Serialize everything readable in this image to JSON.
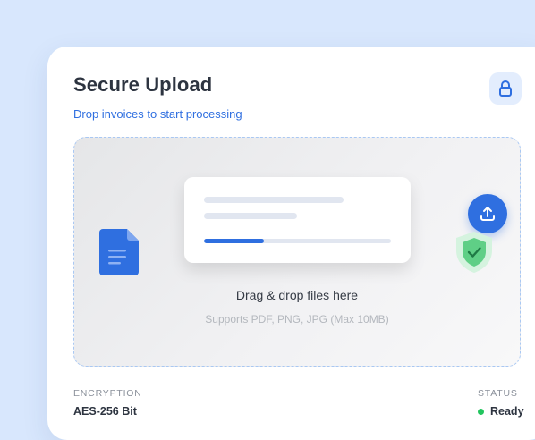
{
  "header": {
    "title": "Secure Upload",
    "subtitle": "Drop invoices to start processing",
    "lock_icon": "lock-icon"
  },
  "dropzone": {
    "title": "Drag & drop files here",
    "hint": "Supports PDF, PNG, JPG (Max 10MB)",
    "upload_icon": "upload-icon",
    "file_icon": "file-icon",
    "shield_icon": "shield-check-icon",
    "upload_progress_percent": 32
  },
  "meta": {
    "encryption_label": "ENCRYPTION",
    "encryption_value": "AES-256 Bit",
    "status_label": "STATUS",
    "status_value": "Ready"
  },
  "colors": {
    "accent": "#2f6fe0",
    "page_background": "#d8e7fd",
    "status_ready": "#22c55e",
    "shield": "#5fcf86"
  }
}
